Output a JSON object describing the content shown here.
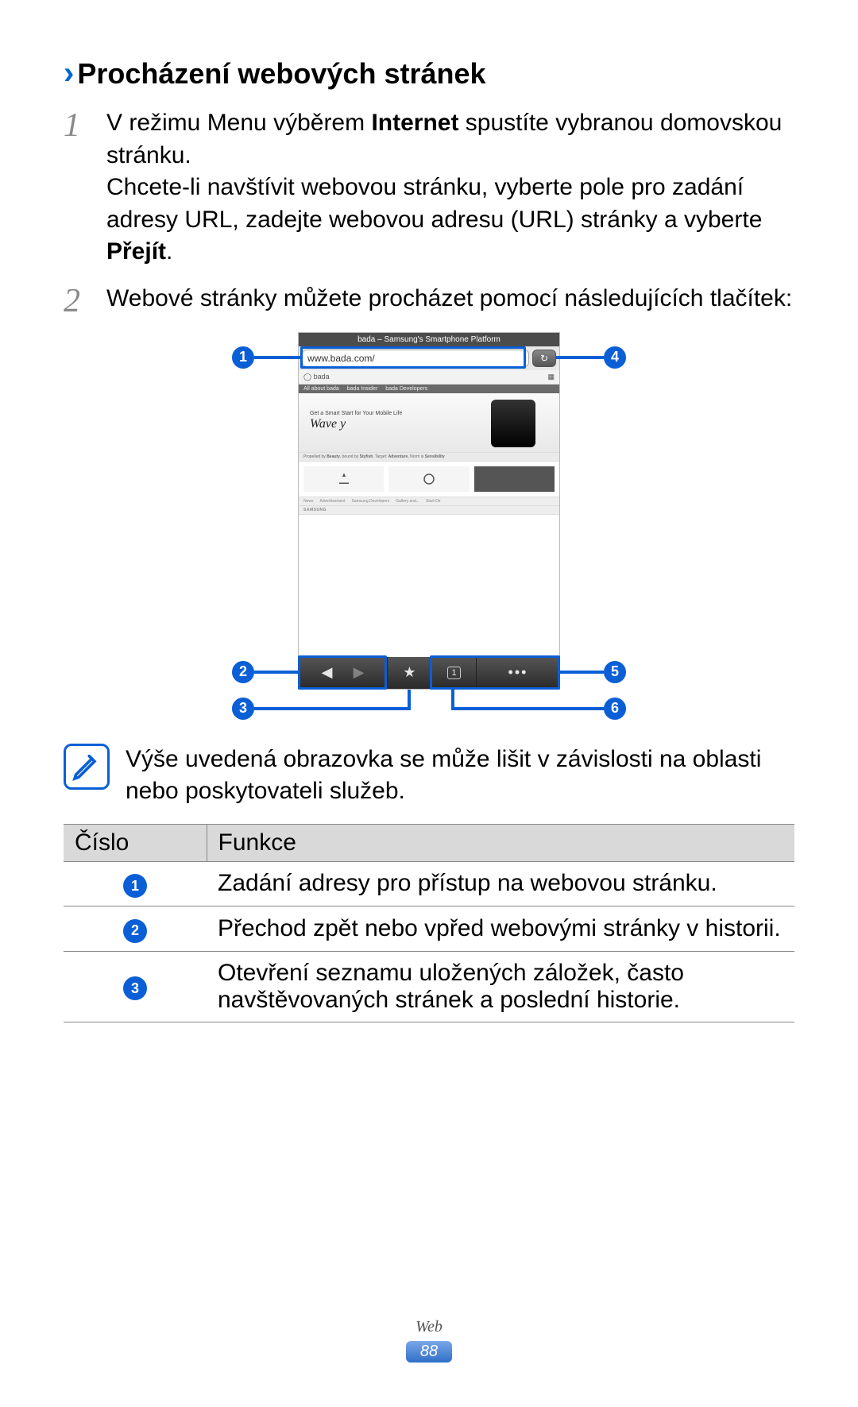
{
  "title": "Procházení webových stránek",
  "steps": [
    {
      "num": "1",
      "text_before": "V režimu Menu výběrem ",
      "text_bold1": "Internet",
      "text_mid": " spustíte vybranou domovskou stránku.",
      "text2": "Chcete-li navštívit webovou stránku, vyberte pole pro zadání adresy URL, zadejte webovou adresu (URL) stránky a vyberte ",
      "text_bold2": "Přejít",
      "text_end": "."
    },
    {
      "num": "2",
      "text_before": "Webové stránky můžete procházet pomocí následujících tlačítek:",
      "text_bold1": "",
      "text_mid": "",
      "text2": "",
      "text_bold2": "",
      "text_end": ""
    }
  ],
  "browser": {
    "header_title": "bada – Samsung's Smartphone Platform",
    "url": "www.bada.com/",
    "site_brand": "bada",
    "hero_tagline": "Get a Smart Start for Your Mobile Life",
    "hero_brand": "Wave y"
  },
  "callouts": {
    "c1": "1",
    "c2": "2",
    "c3": "3",
    "c4": "4",
    "c5": "5",
    "c6": "6"
  },
  "note": "Výše uvedená obrazovka se může lišit v závislosti na oblasti nebo poskytovateli služeb.",
  "table": {
    "head_num": "Číslo",
    "head_func": "Funkce",
    "rows": [
      {
        "id": "1",
        "func": "Zadání adresy pro přístup na webovou stránku."
      },
      {
        "id": "2",
        "func": "Přechod zpět nebo vpřed webovými stránky v historii."
      },
      {
        "id": "3",
        "func": "Otevření seznamu uložených záložek, často navštěvovaných stránek a poslední historie."
      }
    ]
  },
  "footer": {
    "section": "Web",
    "page": "88"
  }
}
